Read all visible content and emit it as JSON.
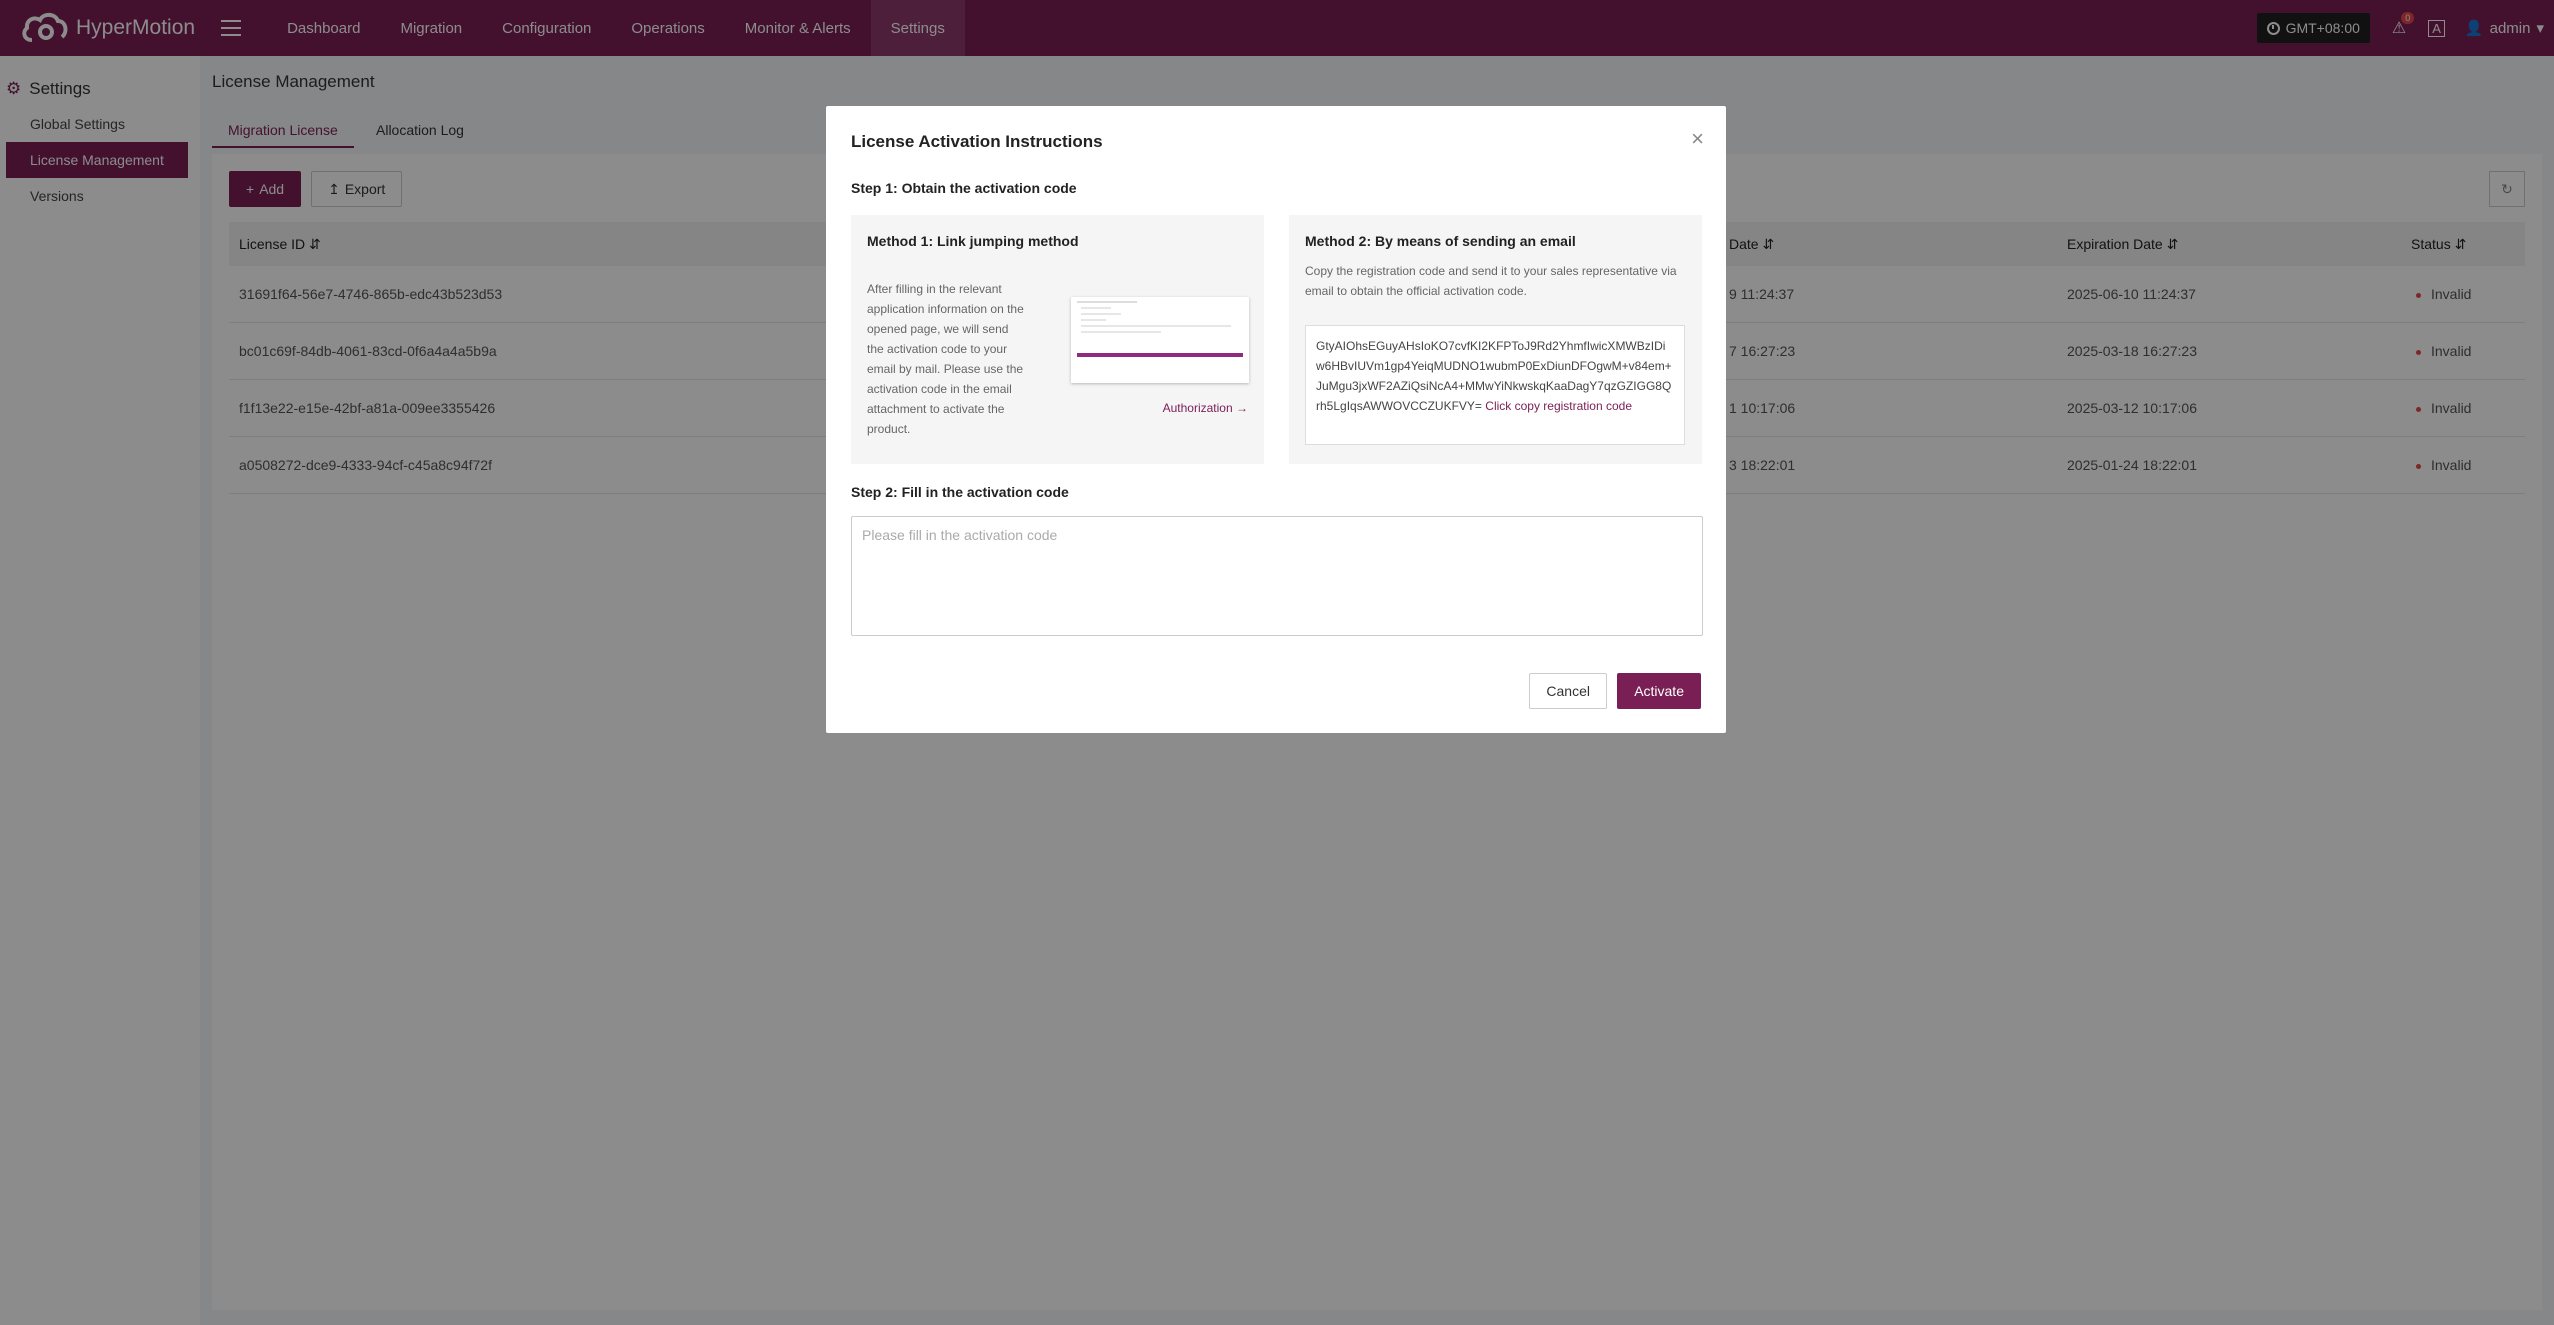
{
  "app": {
    "name": "HyperMotion"
  },
  "nav": {
    "items": [
      "Dashboard",
      "Migration",
      "Configuration",
      "Operations",
      "Monitor & Alerts",
      "Settings"
    ],
    "active": "Settings"
  },
  "topright": {
    "timezone": "GMT+08:00",
    "alert_count": "0",
    "user": "admin"
  },
  "sidebar": {
    "title": "Settings",
    "items": [
      "Global Settings",
      "License Management",
      "Versions"
    ]
  },
  "page": {
    "title": "License Management",
    "tabs": [
      "Migration License",
      "Allocation Log"
    ]
  },
  "toolbar": {
    "add_label": "Add",
    "export_label": "Export"
  },
  "table": {
    "headers": {
      "license_id": "License ID",
      "date": "Date",
      "expiration": "Expiration Date",
      "status": "Status"
    },
    "rows": [
      {
        "id": "31691f64-56e7-4746-865b-edc43b523d53",
        "date": "9 11:24:37",
        "expiration": "2025-06-10 11:24:37",
        "status": "Invalid"
      },
      {
        "id": "bc01c69f-84db-4061-83cd-0f6a4a4a5b9a",
        "date": "7 16:27:23",
        "expiration": "2025-03-18 16:27:23",
        "status": "Invalid"
      },
      {
        "id": "f1f13e22-e15e-42bf-a81a-009ee3355426",
        "date": "1 10:17:06",
        "expiration": "2025-03-12 10:17:06",
        "status": "Invalid"
      },
      {
        "id": "a0508272-dce9-4333-94cf-c45a8c94f72f",
        "date": "3 18:22:01",
        "expiration": "2025-01-24 18:22:01",
        "status": "Invalid"
      }
    ]
  },
  "modal": {
    "title": "License Activation Instructions",
    "step1": "Step 1: Obtain the activation code",
    "method1": {
      "title": "Method 1: Link jumping method",
      "text": "After filling in the relevant application information on the opened page, we will send the activation code to your email by mail. Please use the activation code in the email attachment to activate the product.",
      "link": "Authorization →"
    },
    "method2": {
      "title": "Method 2: By means of sending an email",
      "text": "Copy the registration code and send it to your sales representative via email to obtain the official activation code.",
      "code": "GtyAIOhsEGuyAHsIoKO7cvfKI2KFPToJ9Rd2YhmfIwicXMWBzIDiw6HBvIUVm1gp4YeiqMUDNO1wubmP0ExDiunDFOgwM+v84em+JuMgu3jxWF2AZiQsiNcA4+MMwYiNkwskqKaaDagY7qzGZIGG8Qrh5LgIqsAWWOVCCZUKFVY=",
      "copy": "Click copy registration code"
    },
    "step2": "Step 2: Fill in the activation code",
    "placeholder": "Please fill in the activation code",
    "cancel": "Cancel",
    "activate": "Activate"
  }
}
